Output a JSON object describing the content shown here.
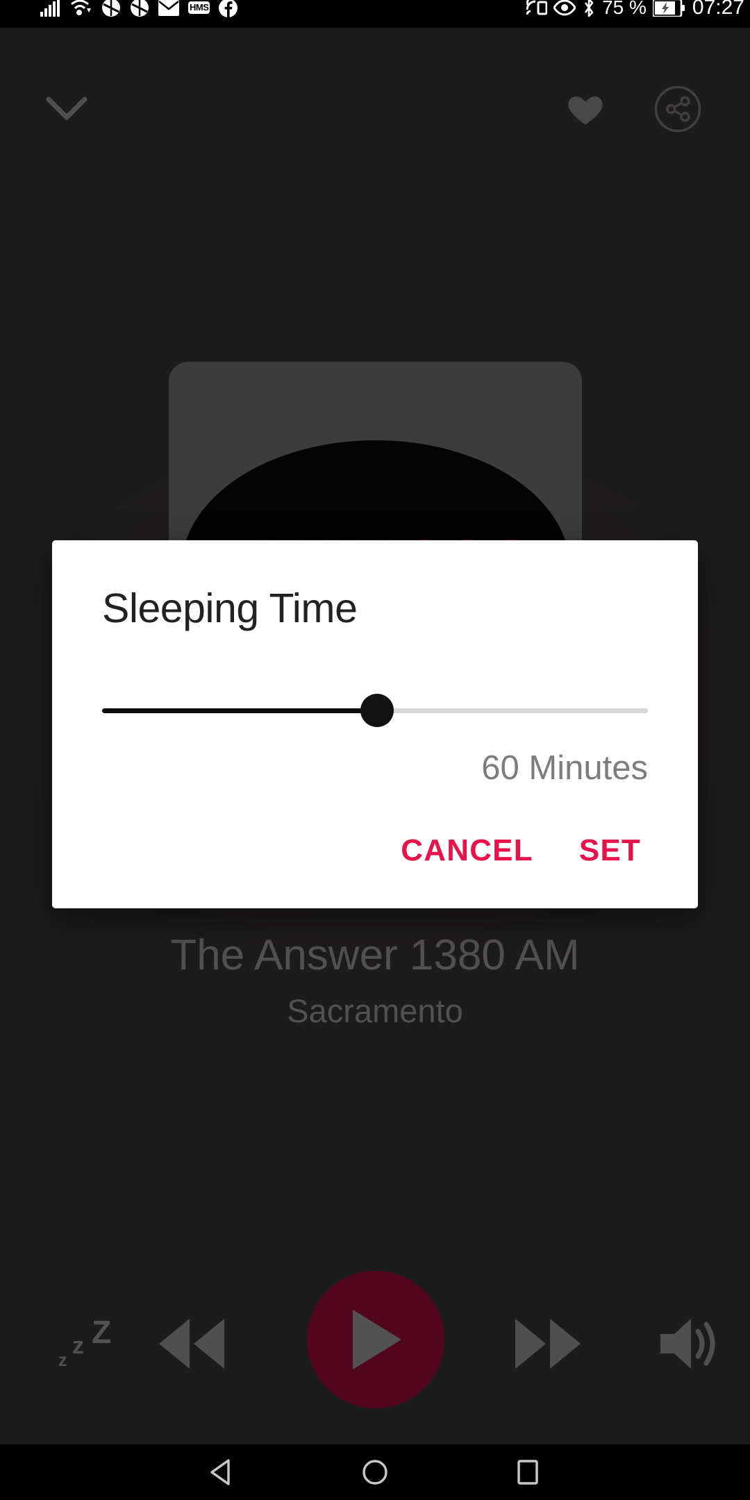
{
  "status_bar": {
    "time": "07:27",
    "battery_percent": "75 %",
    "left_icons": [
      "signal-bars-icon",
      "wifi-icon",
      "app-alert-1-icon",
      "app-alert-2-icon",
      "email-icon",
      "hms-badge-icon",
      "facebook-icon"
    ],
    "hms_label": "HMS",
    "right_icons": [
      "cast-icon",
      "eye-icon",
      "bluetooth-icon",
      "battery-icon"
    ]
  },
  "player": {
    "collapse_icon": "chevron-down-icon",
    "favorite_icon": "heart-icon",
    "share_icon": "share-icon",
    "album_art_text": "AM1380",
    "station_title": "The Answer 1380 AM",
    "station_location": "Sacramento",
    "controls": {
      "sleep_label": "zZ",
      "sleep_icon": "sleep-timer-icon",
      "rewind_icon": "rewind-icon",
      "play_icon": "play-icon",
      "forward_icon": "fast-forward-icon",
      "volume_icon": "volume-icon"
    },
    "accent_color": "#8d0b33"
  },
  "dialog": {
    "title": "Sleeping Time",
    "slider": {
      "value": 60,
      "display_value": "60 Minutes",
      "min": 0,
      "max": 120,
      "percent": 50.4
    },
    "cancel_label": "CANCEL",
    "set_label": "SET",
    "action_color": "#e8134a"
  },
  "navigation_bar": {
    "back_icon": "back-triangle-icon",
    "home_icon": "home-circle-icon",
    "recents_icon": "recents-square-icon"
  }
}
